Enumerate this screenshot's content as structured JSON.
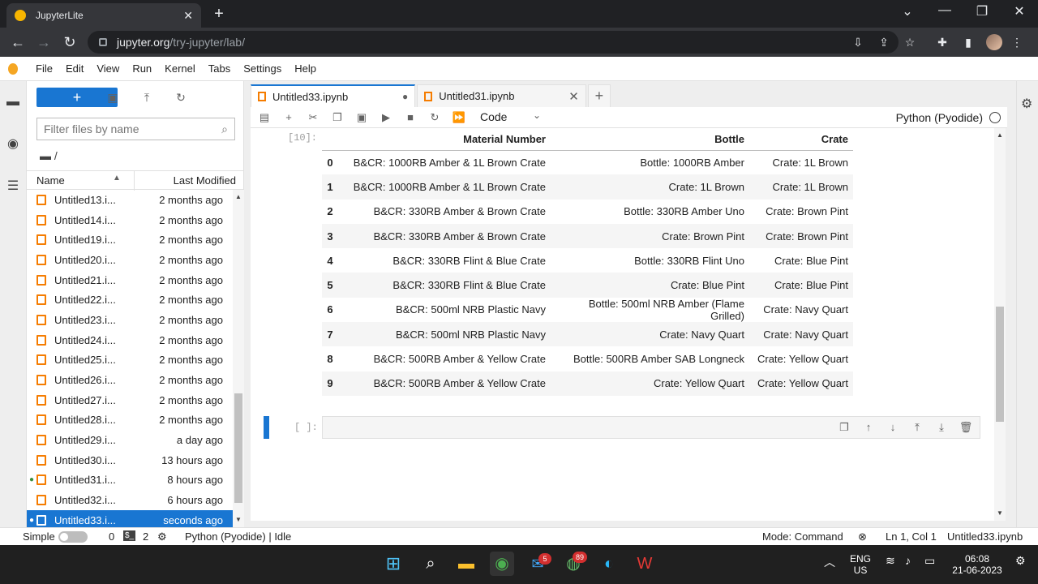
{
  "browser": {
    "tab_title": "JupyterLite",
    "new_tab": "+",
    "url_host": "jupyter.org",
    "url_path": "/try-jupyter/lab/"
  },
  "menu": [
    "File",
    "Edit",
    "View",
    "Run",
    "Kernel",
    "Tabs",
    "Settings",
    "Help"
  ],
  "filebrowser": {
    "new_label": "+",
    "filter_placeholder": "Filter files by name",
    "breadcrumb": "/",
    "col_name": "Name",
    "col_modified": "Last Modified",
    "files": [
      {
        "name": "Untitled13.i...",
        "modified": "2 months ago",
        "running": false,
        "selected": false
      },
      {
        "name": "Untitled14.i...",
        "modified": "2 months ago",
        "running": false,
        "selected": false
      },
      {
        "name": "Untitled19.i...",
        "modified": "2 months ago",
        "running": false,
        "selected": false
      },
      {
        "name": "Untitled20.i...",
        "modified": "2 months ago",
        "running": false,
        "selected": false
      },
      {
        "name": "Untitled21.i...",
        "modified": "2 months ago",
        "running": false,
        "selected": false
      },
      {
        "name": "Untitled22.i...",
        "modified": "2 months ago",
        "running": false,
        "selected": false
      },
      {
        "name": "Untitled23.i...",
        "modified": "2 months ago",
        "running": false,
        "selected": false
      },
      {
        "name": "Untitled24.i...",
        "modified": "2 months ago",
        "running": false,
        "selected": false
      },
      {
        "name": "Untitled25.i...",
        "modified": "2 months ago",
        "running": false,
        "selected": false
      },
      {
        "name": "Untitled26.i...",
        "modified": "2 months ago",
        "running": false,
        "selected": false
      },
      {
        "name": "Untitled27.i...",
        "modified": "2 months ago",
        "running": false,
        "selected": false
      },
      {
        "name": "Untitled28.i...",
        "modified": "2 months ago",
        "running": false,
        "selected": false
      },
      {
        "name": "Untitled29.i...",
        "modified": "a day ago",
        "running": false,
        "selected": false
      },
      {
        "name": "Untitled30.i...",
        "modified": "13 hours ago",
        "running": false,
        "selected": false
      },
      {
        "name": "Untitled31.i...",
        "modified": "8 hours ago",
        "running": true,
        "selected": false
      },
      {
        "name": "Untitled32.i...",
        "modified": "6 hours ago",
        "running": false,
        "selected": false
      },
      {
        "name": "Untitled33.i...",
        "modified": "seconds ago",
        "running": true,
        "selected": true
      }
    ]
  },
  "doc_tabs": [
    {
      "label": "Untitled33.ipynb",
      "active": true,
      "dirty": true
    },
    {
      "label": "Untitled31.ipynb",
      "active": false,
      "dirty": false
    }
  ],
  "notebook_toolbar": {
    "cell_type": "Code",
    "kernel": "Python (Pyodide)"
  },
  "output": {
    "prompt": "[10]:",
    "columns": [
      "",
      "Material Number",
      "Bottle",
      "Crate"
    ],
    "rows": [
      [
        "0",
        "B&CR: 1000RB Amber & 1L Brown Crate",
        "Bottle: 1000RB Amber",
        "Crate: 1L Brown"
      ],
      [
        "1",
        "B&CR: 1000RB Amber & 1L Brown Crate",
        "Crate: 1L Brown",
        "Crate: 1L Brown"
      ],
      [
        "2",
        "B&CR: 330RB Amber & Brown Crate",
        "Bottle: 330RB Amber Uno",
        "Crate: Brown Pint"
      ],
      [
        "3",
        "B&CR: 330RB Amber & Brown Crate",
        "Crate: Brown Pint",
        "Crate: Brown Pint"
      ],
      [
        "4",
        "B&CR: 330RB Flint & Blue Crate",
        "Bottle: 330RB Flint Uno",
        "Crate: Blue Pint"
      ],
      [
        "5",
        "B&CR: 330RB Flint & Blue Crate",
        "Crate: Blue Pint",
        "Crate: Blue Pint"
      ],
      [
        "6",
        "B&CR: 500ml NRB Plastic Navy",
        "Bottle: 500ml NRB Amber (Flame Grilled)",
        "Crate: Navy Quart"
      ],
      [
        "7",
        "B&CR: 500ml NRB Plastic Navy",
        "Crate: Navy Quart",
        "Crate: Navy Quart"
      ],
      [
        "8",
        "B&CR: 500RB Amber & Yellow Crate",
        "Bottle: 500RB Amber SAB Longneck",
        "Crate: Yellow Quart"
      ],
      [
        "9",
        "B&CR: 500RB Amber & Yellow Crate",
        "Crate: Yellow Quart",
        "Crate: Yellow Quart"
      ]
    ]
  },
  "input_cell": {
    "prompt": "[ ]:"
  },
  "statusbar": {
    "simple": "Simple",
    "terminals": "0",
    "kernels": "2",
    "kernel_status": "Python (Pyodide) | Idle",
    "mode": "Mode: Command",
    "position": "Ln 1, Col 1",
    "filename": "Untitled33.ipynb"
  },
  "taskbar": {
    "mail_badge": "5",
    "whatsapp_badge": "89",
    "lang_line1": "ENG",
    "lang_line2": "US",
    "time": "06:08",
    "date": "21-06-2023"
  }
}
